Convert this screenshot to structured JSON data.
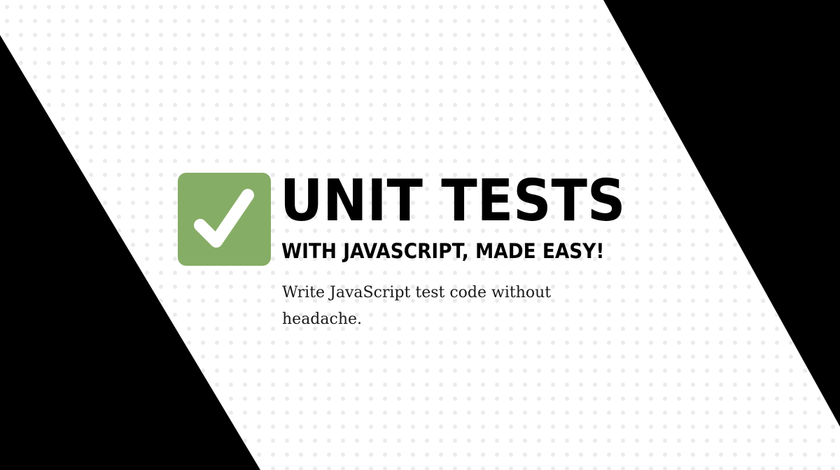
{
  "banner": {
    "title": "UNIT TESTS",
    "subtitle": "WITH JAVASCRIPT, MADE EASY!",
    "description": "Write JavaScript test code without headache."
  },
  "icons": {
    "check": "checkmark-icon"
  },
  "colors": {
    "background_dark": "#000000",
    "panel": "#ffffff",
    "dot_pattern": "#ebebeb",
    "check_box": "#86ad66",
    "check_mark": "#ffffff",
    "text": "#000000"
  }
}
